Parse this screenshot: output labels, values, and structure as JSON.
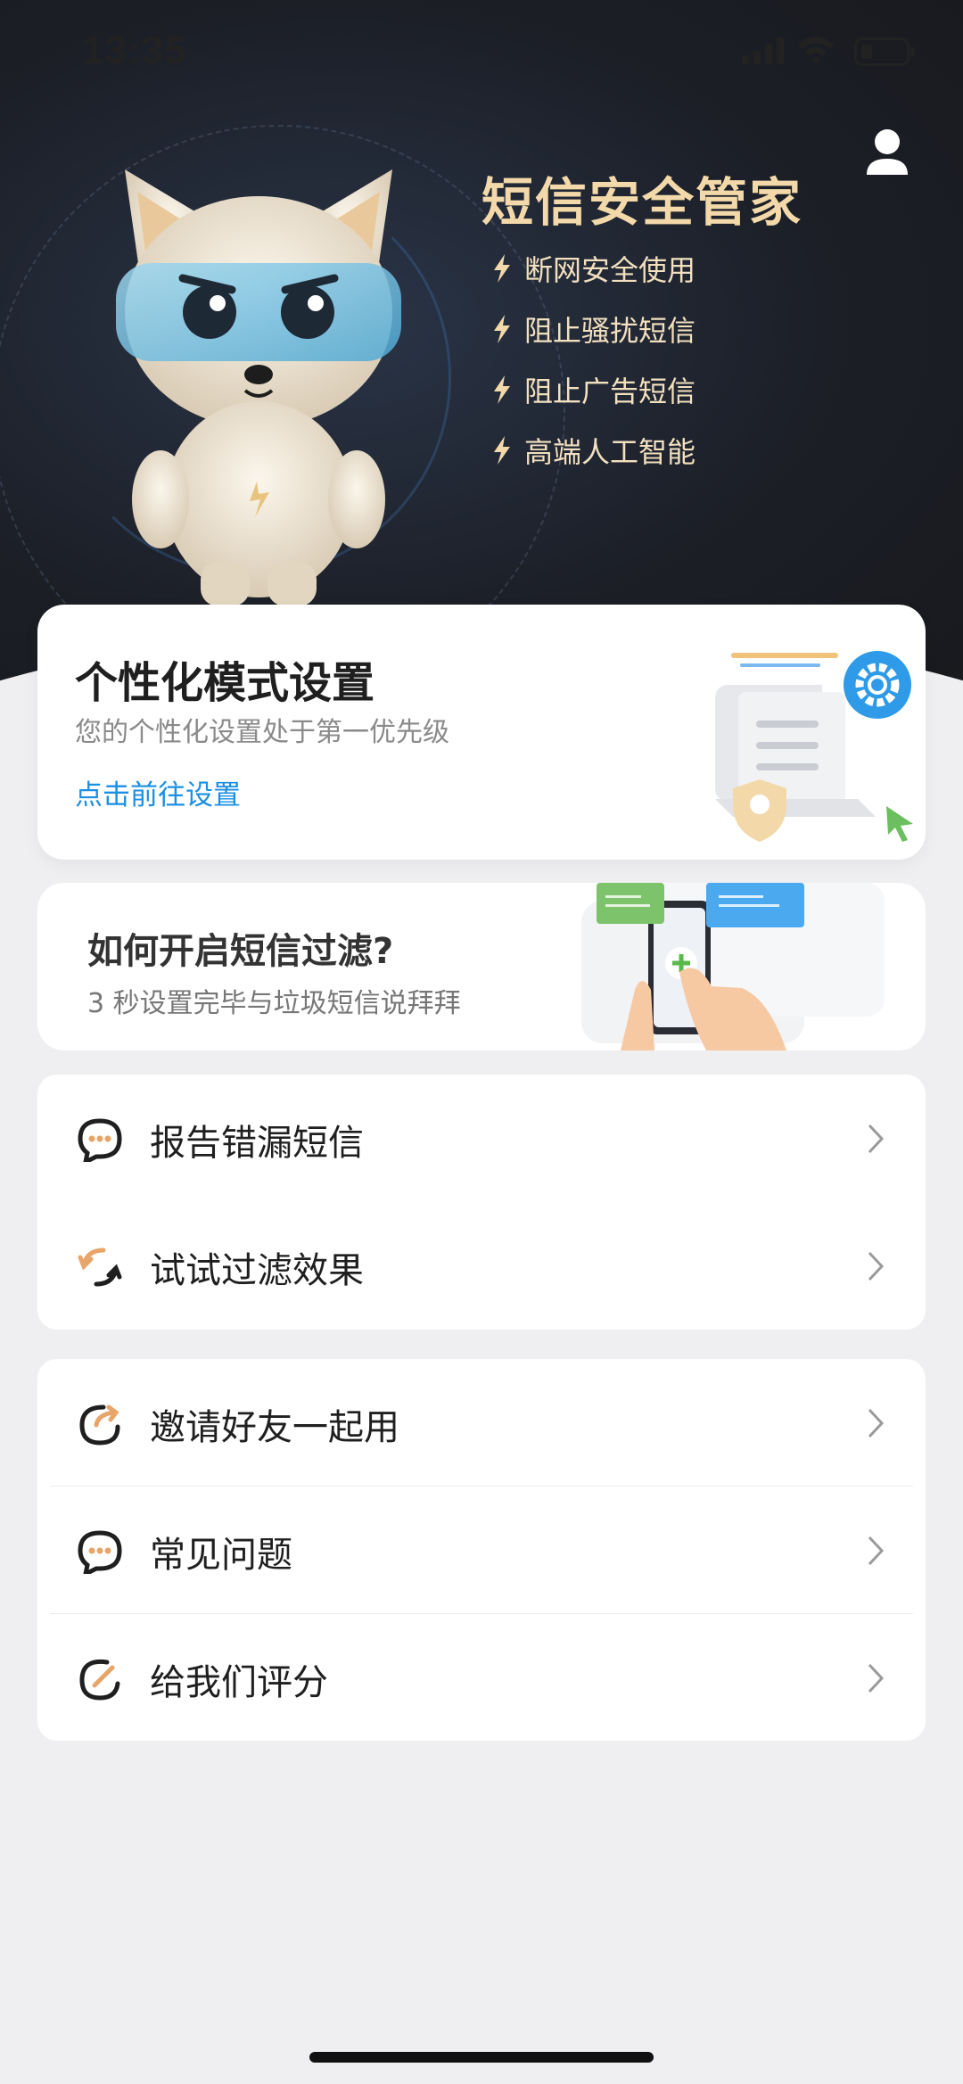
{
  "status_bar": {
    "time": "13:35"
  },
  "hero": {
    "title": "短信安全管家",
    "features": [
      "断网安全使用",
      "阻止骚扰短信",
      "阻止广告短信",
      "高端人工智能"
    ]
  },
  "personalize_card": {
    "title": "个性化模式设置",
    "subtitle": "您的个性化设置处于第一优先级",
    "link": "点击前往设置"
  },
  "filter_card": {
    "title": "如何开启短信过滤?",
    "subtitle": "3 秒设置完毕与垃圾短信说拜拜"
  },
  "menu_group_1": [
    {
      "label": "报告错漏短信",
      "icon": "chat-bubble-icon"
    },
    {
      "label": "试试过滤效果",
      "icon": "refresh-icon"
    }
  ],
  "menu_group_2": [
    {
      "label": "邀请好友一起用",
      "icon": "share-icon"
    },
    {
      "label": "常见问题",
      "icon": "chat-bubble-icon"
    },
    {
      "label": "给我们评分",
      "icon": "rate-pen-icon"
    }
  ],
  "colors": {
    "accent": "#1a8fe3",
    "hero_title": "#f3d9a9",
    "icon_orange": "#e7a56a"
  }
}
